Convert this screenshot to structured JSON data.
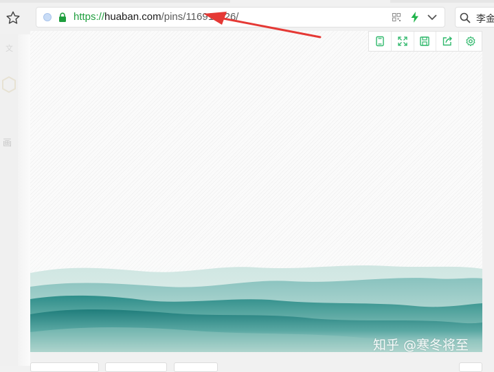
{
  "browser": {
    "url": {
      "scheme": "https://",
      "domain": "huaban.com",
      "path": "/pins/116",
      "path_hidden": "911826/"
    },
    "search_text": "李金"
  },
  "sidebar": {
    "ghost_text_top": "文",
    "ghost_text": "画"
  },
  "toolbar": {
    "buttons": [
      {
        "name": "phone-view-icon"
      },
      {
        "name": "fullscreen-icon"
      },
      {
        "name": "save-icon"
      },
      {
        "name": "share-icon"
      },
      {
        "name": "settings-icon"
      }
    ]
  },
  "watermark": "知乎 @寒冬将至",
  "colors": {
    "accent": "#1f9e3e",
    "arrow": "#e53935",
    "mountain_dark": "#2f8f8c",
    "mountain_light": "#8fc8c4"
  }
}
